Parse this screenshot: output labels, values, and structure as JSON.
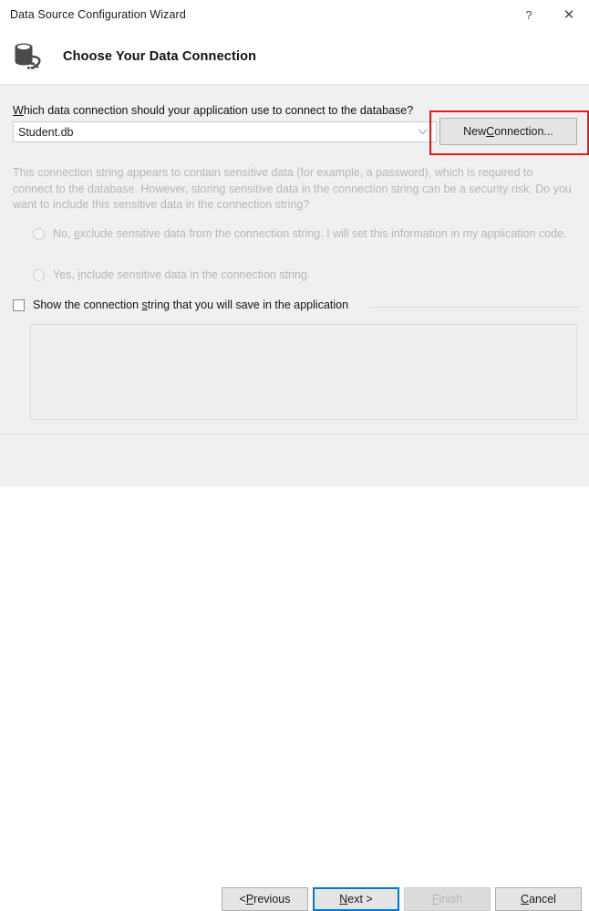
{
  "window": {
    "title": "Data Source Configuration Wizard",
    "help_icon": "?",
    "close_icon": "✕"
  },
  "header": {
    "icon": "database-connection-icon",
    "title": "Choose Your Data Connection"
  },
  "main": {
    "question_label": {
      "accel": "W",
      "rest": "hich data connection should your application use to connect to the database?"
    },
    "connection_combo": {
      "value": "Student.db",
      "arrow_icon": "chevron-down-icon"
    },
    "new_connection_button": {
      "pre": "New ",
      "accel": "C",
      "post": "onnection..."
    },
    "annotation": {
      "shape": "rectangle",
      "color": "#e01b1b",
      "target": "new-connection-button"
    },
    "description": "This connection string appears to contain sensitive data (for example, a password), which is required to connect to the database. However, storing sensitive data in the connection string can be a security risk. Do you want to include this sensitive data in the connection string?",
    "radios": [
      {
        "pre": "No, ",
        "accel": "e",
        "post": "xclude sensitive data from the connection string. I will set this information in my application code.",
        "selected": false,
        "enabled": false
      },
      {
        "pre": "Yes, ",
        "accel": "i",
        "post": "nclude sensitive data in the connection string.",
        "selected": false,
        "enabled": false
      }
    ],
    "show_string_checkbox": {
      "pre": "Show the connection ",
      "accel": "s",
      "post": "tring that you will save in the application",
      "checked": false
    },
    "connection_string_value": ""
  },
  "footer": {
    "buttons": [
      {
        "pre": "< ",
        "accel": "P",
        "post": "revious",
        "enabled": true,
        "default": false
      },
      {
        "pre": "",
        "accel": "N",
        "post": "ext >",
        "enabled": true,
        "default": true
      },
      {
        "pre": "",
        "accel": "F",
        "post": "inish",
        "enabled": false,
        "default": false
      },
      {
        "pre": "",
        "accel": "C",
        "post": "ancel",
        "enabled": true,
        "default": false
      }
    ]
  },
  "colors": {
    "accent": "#0078d7",
    "annotation": "#e01b1b",
    "body_bg": "#f0f0f0",
    "disabled_text": "#b6b6b6"
  }
}
